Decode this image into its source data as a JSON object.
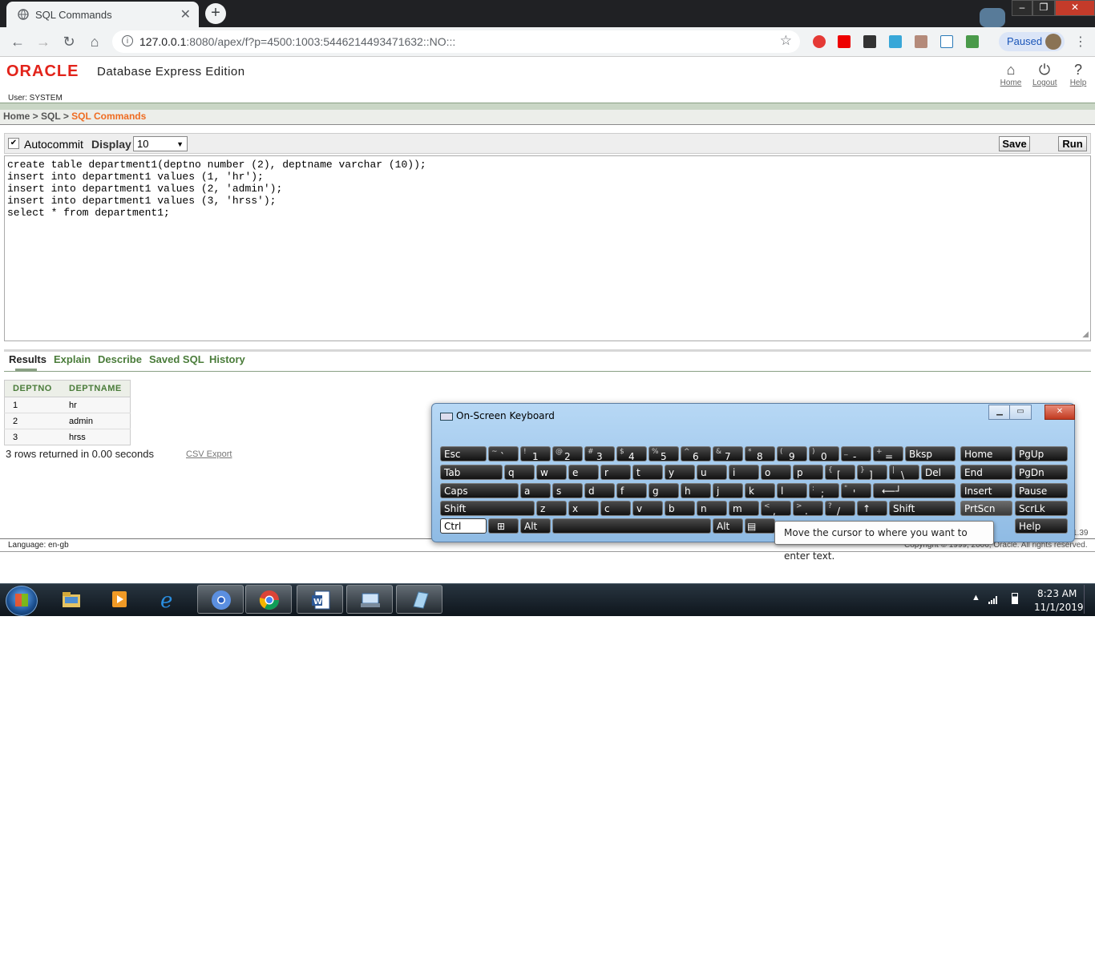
{
  "browser": {
    "tab_title": "SQL Commands",
    "url_host": "127.0.0.1",
    "url_rest": ":8080/apex/f?p=4500:1003:5446214493471632::NO:::",
    "profile_status": "Paused"
  },
  "header": {
    "logo": "ORACLE",
    "product": "Database Express Edition",
    "user_line": "User: SYSTEM",
    "links": [
      {
        "label": "Home",
        "icon": "home-icon"
      },
      {
        "label": "Logout",
        "icon": "power-icon"
      },
      {
        "label": "Help",
        "icon": "question-icon"
      }
    ]
  },
  "breadcrumb": {
    "home": "Home",
    "sep1": " > ",
    "sql": "SQL",
    "sep2": " > ",
    "current": "SQL Commands"
  },
  "commandbar": {
    "autocommit_label": "Autocommit",
    "autocommit_checked": true,
    "display_label": "Display",
    "display_value": "10",
    "save_label": "Save",
    "run_label": "Run"
  },
  "editor": {
    "text": "create table department1(deptno number (2), deptname varchar (10));\ninsert into department1 values (1, 'hr');\ninsert into department1 values (2, 'admin');\ninsert into department1 values (3, 'hrss');\nselect * from department1;"
  },
  "result_tabs": [
    "Results",
    "Explain",
    "Describe",
    "Saved SQL",
    "History"
  ],
  "results": {
    "columns": [
      "DEPTNO",
      "DEPTNAME"
    ],
    "rows": [
      [
        "1",
        "hr"
      ],
      [
        "2",
        "admin"
      ],
      [
        "3",
        "hrss"
      ]
    ],
    "summary": "3 rows returned in 0.00 seconds",
    "csv_export": "CSV Export"
  },
  "footer": {
    "language": "Language: en-gb",
    "copyright": "Copyright © 1999, 2006, Oracle. All rights reserved.",
    "version": "1.39"
  },
  "osk": {
    "title": "On-Screen Keyboard",
    "tooltip": "Move the cursor to where you want to enter text.",
    "keys": {
      "esc": "Esc",
      "bksp": "Bksp",
      "home": "Home",
      "pgup": "PgUp",
      "tab": "Tab",
      "del": "Del",
      "end": "End",
      "pgdn": "PgDn",
      "caps": "Caps",
      "insert": "Insert",
      "pause": "Pause",
      "shift": "Shift",
      "prtscn": "PrtScn",
      "scrlk": "ScrLk",
      "ctrl": "Ctrl",
      "alt": "Alt",
      "help": "Help"
    }
  },
  "taskbar": {
    "time": "8:23 AM",
    "date": "11/1/2019"
  }
}
